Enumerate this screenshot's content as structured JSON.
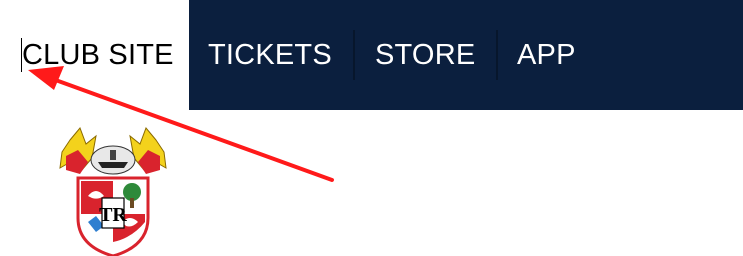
{
  "nav": {
    "active_label": "CLUB SITE",
    "items": [
      {
        "label": "TICKETS"
      },
      {
        "label": "STORE"
      },
      {
        "label": "APP"
      }
    ]
  },
  "colors": {
    "nav_background": "#0b1f3e",
    "active_background": "#ffffff",
    "nav_text": "#ffffff",
    "active_text": "#000000",
    "annotation_arrow": "#ff1a1a"
  },
  "crest": {
    "monogram": "TR"
  }
}
